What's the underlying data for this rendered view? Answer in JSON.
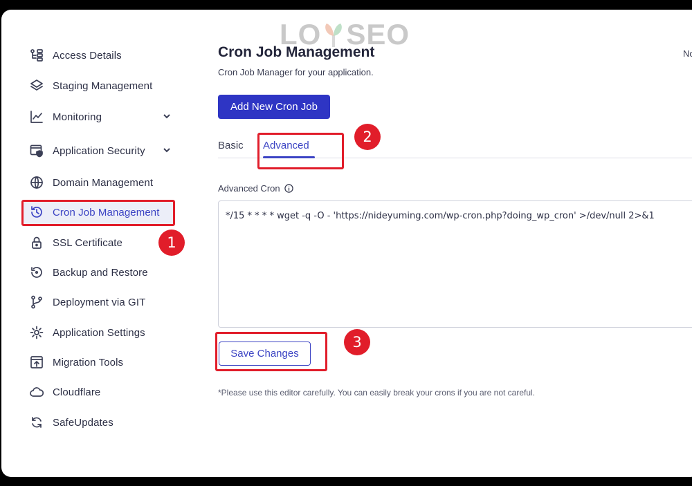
{
  "watermark": {
    "left": "LO",
    "right": "SEO"
  },
  "sidebar": {
    "items": [
      {
        "label": "Access Details",
        "icon": "access-details-icon"
      },
      {
        "label": "Staging Management",
        "icon": "layers-icon"
      },
      {
        "label": "Monitoring",
        "icon": "chart-line-icon"
      },
      {
        "label": "Application Security",
        "icon": "shield-window-icon"
      },
      {
        "label": "Domain Management",
        "icon": "www-globe-icon"
      },
      {
        "label": "Cron Job Management",
        "icon": "history-clock-icon"
      },
      {
        "label": "SSL Certificate",
        "icon": "lock-icon"
      },
      {
        "label": "Backup and Restore",
        "icon": "restore-icon"
      },
      {
        "label": "Deployment via GIT",
        "icon": "git-branch-icon"
      },
      {
        "label": "Application Settings",
        "icon": "gear-icon"
      },
      {
        "label": "Migration Tools",
        "icon": "migration-icon"
      },
      {
        "label": "Cloudflare",
        "icon": "cloud-icon"
      },
      {
        "label": "SafeUpdates",
        "icon": "refresh-icon"
      }
    ]
  },
  "main": {
    "title": "Cron Job Management",
    "subtitle": "Cron Job Manager for your application.",
    "corner_text": "No",
    "add_button": "Add New Cron Job",
    "tabs": [
      {
        "label": "Basic"
      },
      {
        "label": "Advanced",
        "active": true
      }
    ],
    "advanced_label": "Advanced Cron",
    "cron_text": "*/15 * * * * wget -q -O - 'https://nideyuming.com/wp-cron.php?doing_wp_cron' >/dev/null 2>&1",
    "save_button": "Save Changes",
    "note": "*Please use this editor carefully. You can easily break your crons if you are not careful."
  },
  "annotations": {
    "badge1": "1",
    "badge2": "2",
    "badge3": "3"
  },
  "colors": {
    "accent": "#2e35c4",
    "annotation": "#e11d2a",
    "active_bg": "#eceef8"
  }
}
